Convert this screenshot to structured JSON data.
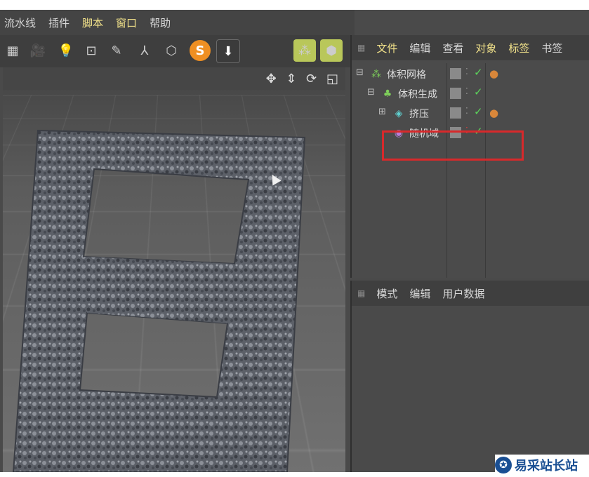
{
  "menubar": {
    "items": [
      {
        "label": "流水线",
        "highlight": false
      },
      {
        "label": "插件",
        "highlight": false
      },
      {
        "label": "脚本",
        "highlight": true
      },
      {
        "label": "窗口",
        "highlight": true
      },
      {
        "label": "帮助",
        "highlight": false
      }
    ]
  },
  "toolbar": {
    "icons": [
      "grid-icon",
      "camera-icon",
      "light-bulb-icon",
      "floor-icon",
      "sketch-icon",
      "character-icon",
      "render-icon",
      "s-plugin-icon",
      "download-icon",
      "volume-mesher-icon",
      "volume-builder-icon"
    ],
    "s_plugin_label": "S"
  },
  "object_manager": {
    "menu": [
      {
        "label": "文件",
        "highlight": true
      },
      {
        "label": "编辑",
        "highlight": false
      },
      {
        "label": "查看",
        "highlight": false
      },
      {
        "label": "对象",
        "highlight": true
      },
      {
        "label": "标签",
        "highlight": true
      },
      {
        "label": "书签",
        "highlight": false
      }
    ],
    "objects": [
      {
        "name": "体积网格",
        "icon": "volume-mesher-icon",
        "has_tag": true
      },
      {
        "name": "体积生成",
        "icon": "volume-builder-icon",
        "has_tag": false
      },
      {
        "name": "挤压",
        "icon": "extrude-icon",
        "has_tag": true
      },
      {
        "name": "随机域",
        "icon": "random-field-icon",
        "has_tag": false
      }
    ]
  },
  "attribute_manager": {
    "menu": [
      "模式",
      "编辑",
      "用户数据"
    ]
  },
  "viewport": {
    "nav_icons": "✥ ⇕ ⟳ ◱"
  },
  "site_logo": {
    "text": "易采站长站",
    "mark": "✪"
  },
  "colors": {
    "accent_yellow": "#f2e28a",
    "highlight_red": "#d8292b",
    "check_green": "#5bd25b"
  }
}
